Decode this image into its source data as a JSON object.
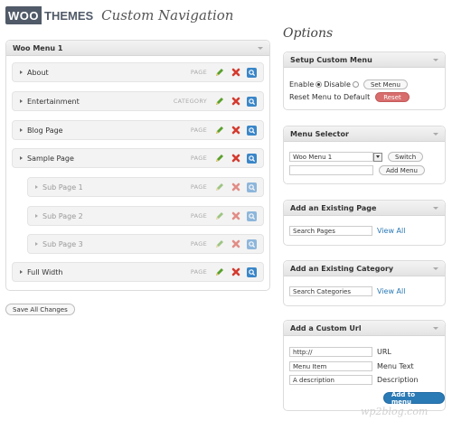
{
  "header": {
    "logo_woo": "WOO",
    "logo_themes": "THEMES",
    "title": "Custom Navigation"
  },
  "menu": {
    "title": "Woo Menu 1",
    "items": [
      {
        "label": "About",
        "type": "PAGE",
        "sub": false
      },
      {
        "label": "Entertainment",
        "type": "CATEGORY",
        "sub": false
      },
      {
        "label": "Blog Page",
        "type": "PAGE",
        "sub": false
      },
      {
        "label": "Sample Page",
        "type": "PAGE",
        "sub": false
      },
      {
        "label": "Sub Page 1",
        "type": "PAGE",
        "sub": true
      },
      {
        "label": "Sub Page 2",
        "type": "PAGE",
        "sub": true
      },
      {
        "label": "Sub Page 3",
        "type": "PAGE",
        "sub": true
      },
      {
        "label": "Full Width",
        "type": "PAGE",
        "sub": false
      }
    ],
    "save_label": "Save All Changes"
  },
  "options": {
    "title": "Options",
    "setup": {
      "title": "Setup Custom Menu",
      "enable": "Enable",
      "disable": "Disable",
      "set_menu": "Set Menu",
      "reset_label": "Reset Menu to Default",
      "reset_btn": "Reset"
    },
    "selector": {
      "title": "Menu Selector",
      "selected": "Woo Menu 1",
      "switch": "Switch",
      "new_value": "",
      "add_menu": "Add Menu"
    },
    "existing_page": {
      "title": "Add an Existing Page",
      "placeholder": "Search Pages",
      "view_all": "View All"
    },
    "existing_category": {
      "title": "Add an Existing Category",
      "placeholder": "Search Categories",
      "view_all": "View All"
    },
    "custom_url": {
      "title": "Add a Custom Url",
      "url_value": "http://",
      "url_label": "URL",
      "text_value": "Menu Item",
      "text_label": "Menu Text",
      "desc_value": "A description",
      "desc_label": "Description",
      "add_btn": "Add to menu"
    }
  },
  "watermark": "wp2blog.com",
  "colors": {
    "logo_bg": "#505a68",
    "reset": "#d86d6d",
    "add_btn": "#2a7ab6",
    "link": "#2a7ab6",
    "view_icon": "#3a86c8",
    "edit_icon": "#5aa02c",
    "delete_icon": "#d43b2f"
  }
}
